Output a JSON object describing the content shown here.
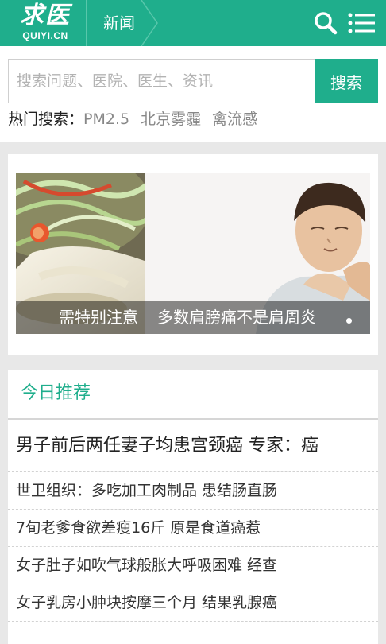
{
  "header": {
    "logo_cn": "求医",
    "logo_en": "QUIYI.CN",
    "section_title": "新闻",
    "search_icon": "search-icon",
    "menu_icon": "menu-icon",
    "brand_color": "#1fae8c"
  },
  "search": {
    "placeholder": "搜索问题、医院、医生、资讯",
    "button_label": "搜索",
    "hot_label": "热门搜索：",
    "hot_terms": [
      "PM2.5",
      "北京雾霾",
      "禽流感"
    ]
  },
  "carousel": {
    "slides": [
      {
        "caption": "需特别注意"
      },
      {
        "caption": "多数肩膀痛不是肩周炎"
      }
    ]
  },
  "recommend": {
    "title": "今日推荐",
    "items": [
      "男子前后两任妻子均患宫颈癌 专家：癌",
      "世卫组织：多吃加工肉制品 患结肠直肠",
      "7旬老爹食欲差瘦16斤 原是食道癌惹",
      "女子肚子如吹气球般胀大呼吸困难 经查",
      "女子乳房小肿块按摩三个月 结果乳腺癌"
    ]
  }
}
